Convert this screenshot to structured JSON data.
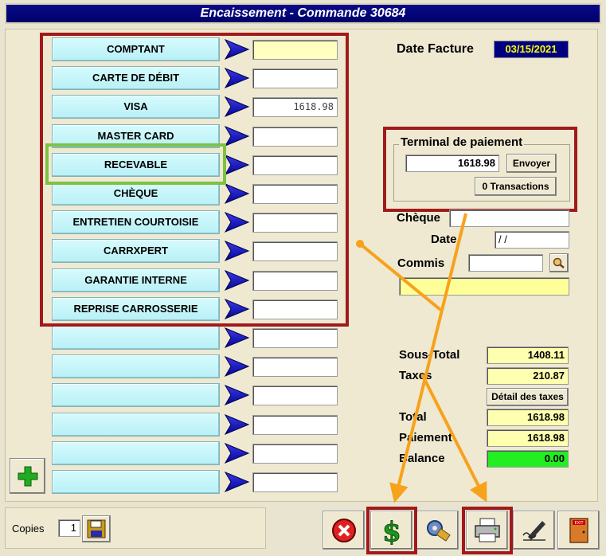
{
  "window": {
    "title": "Encaissement - Commande 30684"
  },
  "payments": [
    {
      "label": "COMPTANT",
      "amount": "",
      "highlight": "yellow"
    },
    {
      "label": "CARTE DE DÉBIT",
      "amount": ""
    },
    {
      "label": "VISA",
      "amount": "1618.98"
    },
    {
      "label": "MASTER CARD",
      "amount": ""
    },
    {
      "label": "RECEVABLE",
      "amount": ""
    },
    {
      "label": "CHÈQUE",
      "amount": ""
    },
    {
      "label": "ENTRETIEN COURTOISIE",
      "amount": ""
    },
    {
      "label": "CARRXPERT",
      "amount": ""
    },
    {
      "label": "GARANTIE INTERNE",
      "amount": ""
    },
    {
      "label": "REPRISE CARROSSERIE",
      "amount": ""
    },
    {
      "label": "",
      "amount": ""
    },
    {
      "label": "",
      "amount": ""
    },
    {
      "label": "",
      "amount": ""
    },
    {
      "label": "",
      "amount": ""
    },
    {
      "label": "",
      "amount": ""
    },
    {
      "label": "",
      "amount": ""
    }
  ],
  "invoice": {
    "date_label": "Date Facture",
    "date_value": "03/15/2021"
  },
  "terminal": {
    "group_label": "Terminal de paiement",
    "amount": "1618.98",
    "send_label": "Envoyer",
    "transactions_label": "0 Transactions"
  },
  "cheque": {
    "label": "Chèque",
    "value": "",
    "date_label": "Date",
    "date_value": " / /",
    "commis_label": "Commis",
    "commis_value": ""
  },
  "totals": {
    "subtotal_label": "Sous-Total",
    "subtotal": "1408.11",
    "taxes_label": "Taxes",
    "taxes": "210.87",
    "tax_detail_label": "Détail des taxes",
    "total_label": "Total",
    "total": "1618.98",
    "payment_label": "Paiement",
    "payment": "1618.98",
    "balance_label": "Balance",
    "balance": "0.00"
  },
  "footer": {
    "copies_label": "Copies",
    "copies_value": "1"
  },
  "colors": {
    "title_bg": "#00006a",
    "button_bg": "#c4f4f8",
    "amount_yellow": "#ffffb0",
    "balance_green": "#22ee22",
    "annotation_red": "#a11a1a",
    "annotation_green": "#7dc242",
    "annotation_orange": "#f7a21b"
  },
  "icons": [
    "play-arrow-icon",
    "plus-icon",
    "floppy-disk-icon",
    "cancel-icon",
    "dollar-icon",
    "settings-icon",
    "printer-icon",
    "signature-icon",
    "exit-door-icon",
    "search-icon"
  ]
}
